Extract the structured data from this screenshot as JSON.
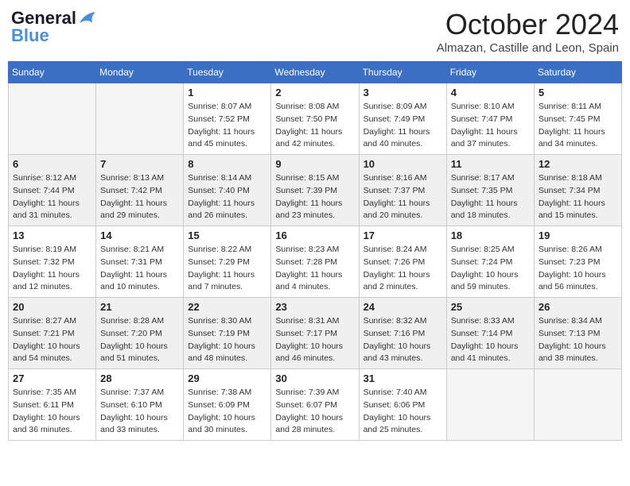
{
  "header": {
    "logo_line1": "General",
    "logo_line2": "Blue",
    "month_title": "October 2024",
    "subtitle": "Almazan, Castille and Leon, Spain"
  },
  "weekdays": [
    "Sunday",
    "Monday",
    "Tuesday",
    "Wednesday",
    "Thursday",
    "Friday",
    "Saturday"
  ],
  "weeks": [
    {
      "shaded": false,
      "days": [
        {
          "num": "",
          "empty": true
        },
        {
          "num": "",
          "empty": true
        },
        {
          "num": "1",
          "sunrise": "Sunrise: 8:07 AM",
          "sunset": "Sunset: 7:52 PM",
          "daylight": "Daylight: 11 hours and 45 minutes."
        },
        {
          "num": "2",
          "sunrise": "Sunrise: 8:08 AM",
          "sunset": "Sunset: 7:50 PM",
          "daylight": "Daylight: 11 hours and 42 minutes."
        },
        {
          "num": "3",
          "sunrise": "Sunrise: 8:09 AM",
          "sunset": "Sunset: 7:49 PM",
          "daylight": "Daylight: 11 hours and 40 minutes."
        },
        {
          "num": "4",
          "sunrise": "Sunrise: 8:10 AM",
          "sunset": "Sunset: 7:47 PM",
          "daylight": "Daylight: 11 hours and 37 minutes."
        },
        {
          "num": "5",
          "sunrise": "Sunrise: 8:11 AM",
          "sunset": "Sunset: 7:45 PM",
          "daylight": "Daylight: 11 hours and 34 minutes."
        }
      ]
    },
    {
      "shaded": true,
      "days": [
        {
          "num": "6",
          "sunrise": "Sunrise: 8:12 AM",
          "sunset": "Sunset: 7:44 PM",
          "daylight": "Daylight: 11 hours and 31 minutes."
        },
        {
          "num": "7",
          "sunrise": "Sunrise: 8:13 AM",
          "sunset": "Sunset: 7:42 PM",
          "daylight": "Daylight: 11 hours and 29 minutes."
        },
        {
          "num": "8",
          "sunrise": "Sunrise: 8:14 AM",
          "sunset": "Sunset: 7:40 PM",
          "daylight": "Daylight: 11 hours and 26 minutes."
        },
        {
          "num": "9",
          "sunrise": "Sunrise: 8:15 AM",
          "sunset": "Sunset: 7:39 PM",
          "daylight": "Daylight: 11 hours and 23 minutes."
        },
        {
          "num": "10",
          "sunrise": "Sunrise: 8:16 AM",
          "sunset": "Sunset: 7:37 PM",
          "daylight": "Daylight: 11 hours and 20 minutes."
        },
        {
          "num": "11",
          "sunrise": "Sunrise: 8:17 AM",
          "sunset": "Sunset: 7:35 PM",
          "daylight": "Daylight: 11 hours and 18 minutes."
        },
        {
          "num": "12",
          "sunrise": "Sunrise: 8:18 AM",
          "sunset": "Sunset: 7:34 PM",
          "daylight": "Daylight: 11 hours and 15 minutes."
        }
      ]
    },
    {
      "shaded": false,
      "days": [
        {
          "num": "13",
          "sunrise": "Sunrise: 8:19 AM",
          "sunset": "Sunset: 7:32 PM",
          "daylight": "Daylight: 11 hours and 12 minutes."
        },
        {
          "num": "14",
          "sunrise": "Sunrise: 8:21 AM",
          "sunset": "Sunset: 7:31 PM",
          "daylight": "Daylight: 11 hours and 10 minutes."
        },
        {
          "num": "15",
          "sunrise": "Sunrise: 8:22 AM",
          "sunset": "Sunset: 7:29 PM",
          "daylight": "Daylight: 11 hours and 7 minutes."
        },
        {
          "num": "16",
          "sunrise": "Sunrise: 8:23 AM",
          "sunset": "Sunset: 7:28 PM",
          "daylight": "Daylight: 11 hours and 4 minutes."
        },
        {
          "num": "17",
          "sunrise": "Sunrise: 8:24 AM",
          "sunset": "Sunset: 7:26 PM",
          "daylight": "Daylight: 11 hours and 2 minutes."
        },
        {
          "num": "18",
          "sunrise": "Sunrise: 8:25 AM",
          "sunset": "Sunset: 7:24 PM",
          "daylight": "Daylight: 10 hours and 59 minutes."
        },
        {
          "num": "19",
          "sunrise": "Sunrise: 8:26 AM",
          "sunset": "Sunset: 7:23 PM",
          "daylight": "Daylight: 10 hours and 56 minutes."
        }
      ]
    },
    {
      "shaded": true,
      "days": [
        {
          "num": "20",
          "sunrise": "Sunrise: 8:27 AM",
          "sunset": "Sunset: 7:21 PM",
          "daylight": "Daylight: 10 hours and 54 minutes."
        },
        {
          "num": "21",
          "sunrise": "Sunrise: 8:28 AM",
          "sunset": "Sunset: 7:20 PM",
          "daylight": "Daylight: 10 hours and 51 minutes."
        },
        {
          "num": "22",
          "sunrise": "Sunrise: 8:30 AM",
          "sunset": "Sunset: 7:19 PM",
          "daylight": "Daylight: 10 hours and 48 minutes."
        },
        {
          "num": "23",
          "sunrise": "Sunrise: 8:31 AM",
          "sunset": "Sunset: 7:17 PM",
          "daylight": "Daylight: 10 hours and 46 minutes."
        },
        {
          "num": "24",
          "sunrise": "Sunrise: 8:32 AM",
          "sunset": "Sunset: 7:16 PM",
          "daylight": "Daylight: 10 hours and 43 minutes."
        },
        {
          "num": "25",
          "sunrise": "Sunrise: 8:33 AM",
          "sunset": "Sunset: 7:14 PM",
          "daylight": "Daylight: 10 hours and 41 minutes."
        },
        {
          "num": "26",
          "sunrise": "Sunrise: 8:34 AM",
          "sunset": "Sunset: 7:13 PM",
          "daylight": "Daylight: 10 hours and 38 minutes."
        }
      ]
    },
    {
      "shaded": false,
      "days": [
        {
          "num": "27",
          "sunrise": "Sunrise: 7:35 AM",
          "sunset": "Sunset: 6:11 PM",
          "daylight": "Daylight: 10 hours and 36 minutes."
        },
        {
          "num": "28",
          "sunrise": "Sunrise: 7:37 AM",
          "sunset": "Sunset: 6:10 PM",
          "daylight": "Daylight: 10 hours and 33 minutes."
        },
        {
          "num": "29",
          "sunrise": "Sunrise: 7:38 AM",
          "sunset": "Sunset: 6:09 PM",
          "daylight": "Daylight: 10 hours and 30 minutes."
        },
        {
          "num": "30",
          "sunrise": "Sunrise: 7:39 AM",
          "sunset": "Sunset: 6:07 PM",
          "daylight": "Daylight: 10 hours and 28 minutes."
        },
        {
          "num": "31",
          "sunrise": "Sunrise: 7:40 AM",
          "sunset": "Sunset: 6:06 PM",
          "daylight": "Daylight: 10 hours and 25 minutes."
        },
        {
          "num": "",
          "empty": true
        },
        {
          "num": "",
          "empty": true
        }
      ]
    }
  ]
}
